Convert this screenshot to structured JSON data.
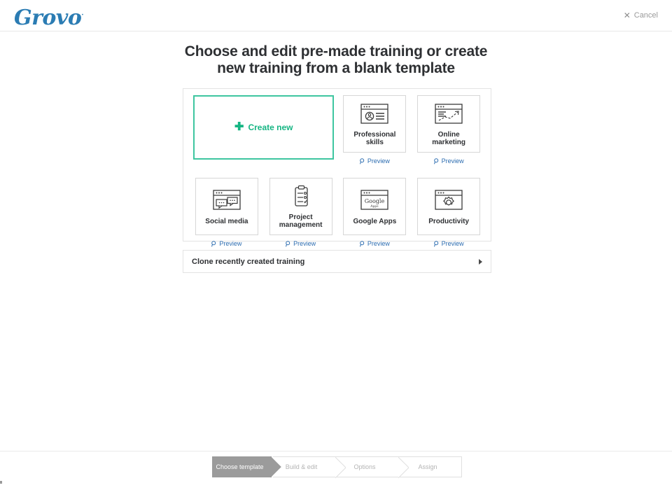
{
  "header": {
    "logo_text": "Grovo",
    "logo_tm": "·",
    "logo_color": "#2b7cb3",
    "cancel_icon": "close-icon",
    "cancel_label": "Cancel"
  },
  "page": {
    "title_line1": "Choose and edit pre-made training or create",
    "title_line2": "new training from a blank template"
  },
  "create_card": {
    "plus_glyph": "✚",
    "label": "Create new",
    "accent_color": "#16b583",
    "border_color": "#3ec6a0"
  },
  "preview_label": "Preview",
  "preview_icon": "magnifier-icon",
  "preview_color": "#2b6cb0",
  "templates": [
    {
      "label": "Professional skills",
      "icon": "browser-person-list-icon",
      "has_preview": true
    },
    {
      "label": "Online marketing",
      "icon": "browser-trend-chart-icon",
      "has_preview": true
    },
    {
      "label": "Social media",
      "icon": "browser-speech-bubbles-icon",
      "has_preview": true
    },
    {
      "label": "Project management",
      "icon": "clipboard-checklist-icon",
      "has_preview": true
    },
    {
      "label": "Google Apps",
      "icon": "browser-google-apps-icon",
      "has_preview": true,
      "inner_text_top": "Google",
      "inner_text_bottom": "Apps"
    },
    {
      "label": "Productivity",
      "icon": "browser-gear-icon",
      "has_preview": true
    }
  ],
  "clone_row": {
    "label": "Clone recently created training",
    "arrow_icon": "chevron-right-icon"
  },
  "wizard": {
    "steps": [
      {
        "label": "Choose template",
        "state": "active"
      },
      {
        "label": "Build & edit",
        "state": "inactive"
      },
      {
        "label": "Options",
        "state": "inactive"
      },
      {
        "label": "Assign",
        "state": "inactive"
      }
    ],
    "active_bg": "#9b9b9b",
    "inactive_text": "#b4b4b4"
  }
}
